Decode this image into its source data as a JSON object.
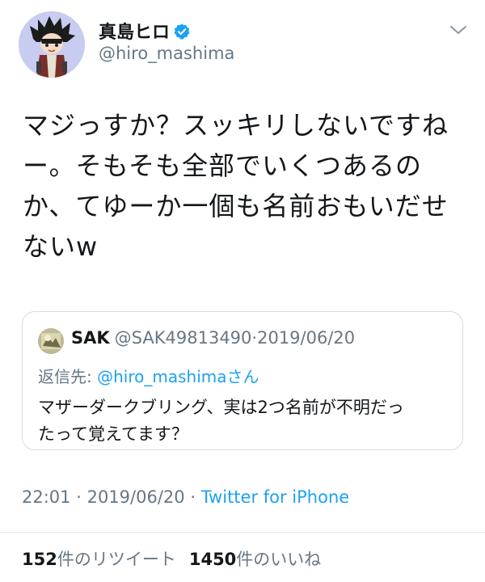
{
  "author": {
    "display_name": "真島ヒロ",
    "handle": "@hiro_mashima",
    "verified": true,
    "avatar_icon": "character-avatar-icon",
    "verified_icon": "verified-badge-icon",
    "menu_icon": "chevron-down-icon"
  },
  "tweet": {
    "text": "マジっすか？スッキリしないですね\nー。そもそも全部でいくつあるの\nか、てゆーか一個も名前おもいだせ\nないw"
  },
  "quoted_tweet": {
    "display_name": "SAK",
    "handle": "@SAK49813490",
    "separator": "·",
    "date": "2019/06/20",
    "reply_prefix": "返信先: ",
    "reply_mention": "@hiro_mashima",
    "reply_suffix": "さん",
    "text": "マザーダークブリング、実は2つ名前が不明だっ\nたって覚えてます？",
    "avatar_icon": "user-avatar-icon"
  },
  "meta": {
    "time": "22:01",
    "separator": "·",
    "date": "2019/06/20",
    "source": "Twitter for iPhone"
  },
  "stats": {
    "retweets_count": "152",
    "retweets_label": "件のリツイート",
    "likes_count": "1450",
    "likes_label": "件のいいね"
  },
  "colors": {
    "link": "#1da1f2",
    "secondary_text": "#657786",
    "primary_text": "#14171a",
    "border": "#d5dce2"
  }
}
